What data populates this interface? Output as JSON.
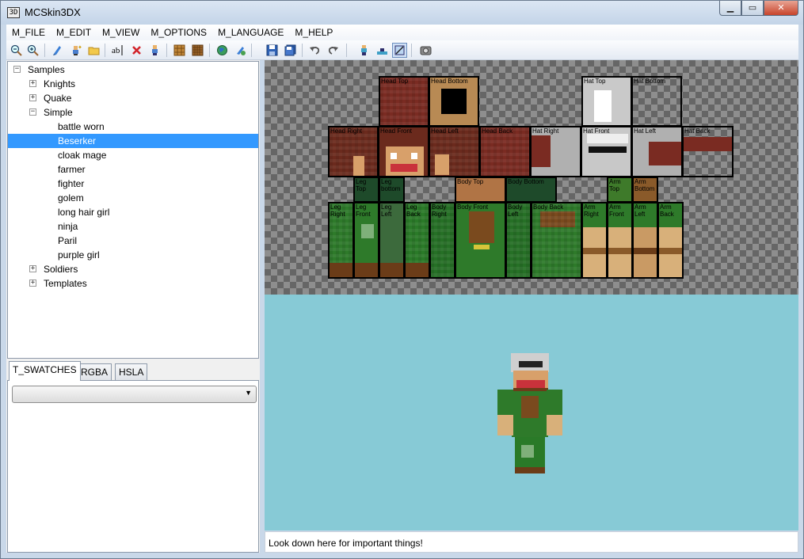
{
  "window": {
    "title": "MCSkin3DX",
    "app_icon": "3D",
    "controls": [
      "minimize-icon",
      "maximize-icon",
      "close-icon"
    ]
  },
  "menu": [
    "M_FILE",
    "M_EDIT",
    "M_VIEW",
    "M_OPTIONS",
    "M_LANGUAGE",
    "M_HELP"
  ],
  "tree": {
    "root": "Samples",
    "items": [
      {
        "label": "Knights",
        "expander": "+"
      },
      {
        "label": "Quake",
        "expander": "+"
      },
      {
        "label": "Simple",
        "expander": "−"
      },
      {
        "label": "battle worn"
      },
      {
        "label": "Beserker",
        "selected": true
      },
      {
        "label": "cloak mage"
      },
      {
        "label": "farmer"
      },
      {
        "label": "fighter"
      },
      {
        "label": "golem"
      },
      {
        "label": "long hair girl"
      },
      {
        "label": "ninja"
      },
      {
        "label": "Paril"
      },
      {
        "label": "purple girl"
      },
      {
        "label": "Soldiers",
        "expander": "+"
      },
      {
        "label": "Templates",
        "expander": "+"
      }
    ]
  },
  "color_tabs": [
    "T_SWATCHES",
    "RGBA",
    "HSLA"
  ],
  "swatch_select": {
    "value": ""
  },
  "uv_labels": {
    "head_top": "Head Top",
    "head_bottom": "Head Bottom",
    "hat_top": "Hat Top",
    "hat_bottom": "Hat Bottom",
    "head_right": "Head Right",
    "head_front": "Head Front",
    "head_left": "Head Left",
    "head_back": "Head Back",
    "hat_right": "Hat Right",
    "hat_front": "Hat Front",
    "hat_left": "Hat Left",
    "hat_back": "Hat Back",
    "leg_top": "Leg\nTop",
    "leg_bottom": "Leg\nbottom",
    "body_top": "Body Top",
    "body_bottom": "Body Bottom",
    "arm_top": "Arm\nTop",
    "arm_bottom": "Arm\nBottom",
    "leg_right": "Leg\nRight",
    "leg_front": "Leg\nFront",
    "leg_left": "Leg\nLeft",
    "leg_back": "Leg\nBack",
    "body_right": "Body\nRight",
    "body_front": "Body Front",
    "body_left": "Body\nLeft",
    "body_back": "Body Back",
    "arm_right": "Arm\nRight",
    "arm_front": "Arm\nFront",
    "arm_left": "Arm\nLeft",
    "arm_back": "Arm\nBack"
  },
  "status": "Look down here for important things!"
}
